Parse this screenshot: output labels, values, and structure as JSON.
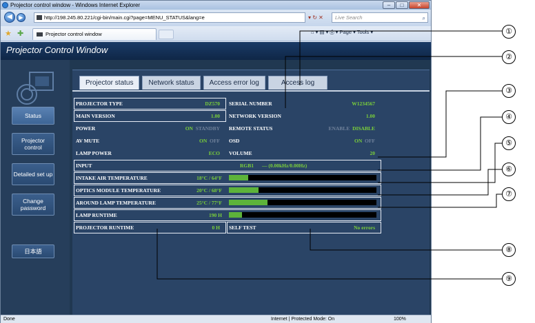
{
  "browser": {
    "title": "Projector control window - Windows Internet Explorer",
    "url": "http://198.245.80.221/cgi-bin/main.cgi?page=MENU_STATUS&lang=e",
    "search_placeholder": "Live Search",
    "tab_title": "Projector control window",
    "command_bar": "Page ▾   Tools ▾",
    "status_done": "Done",
    "status_zone": "Internet | Protected Mode: On",
    "status_zoom": "100%"
  },
  "page": {
    "title": "Projector Control Window",
    "sidebar": [
      {
        "label": "Status"
      },
      {
        "label": "Projector control"
      },
      {
        "label": "Detailed set up"
      },
      {
        "label": "Change password"
      },
      {
        "label": "日本語"
      }
    ],
    "tabs": [
      {
        "label": "Projector status"
      },
      {
        "label": "Network status"
      },
      {
        "label": "Access error log"
      },
      {
        "label": "Access log"
      }
    ]
  },
  "status": {
    "projector_type": {
      "label": "PROJECTOR TYPE",
      "value": "DZ570"
    },
    "serial_number": {
      "label": "SERIAL NUMBER",
      "value": "W1234567"
    },
    "main_version": {
      "label": "MAIN VERSION",
      "value": "1.00"
    },
    "network_version": {
      "label": "NETWORK VERSION",
      "value": "1.00"
    },
    "power": {
      "label": "POWER",
      "on": "ON",
      "standby": "STANDBY"
    },
    "remote_status": {
      "label": "REMOTE STATUS",
      "enable": "ENABLE",
      "disable": "DISABLE"
    },
    "av_mute": {
      "label": "AV MUTE",
      "on": "ON",
      "off": "OFF"
    },
    "osd": {
      "label": "OSD",
      "on": "ON",
      "off": "OFF"
    },
    "lamp_power": {
      "label": "LAMP POWER",
      "value": "ECO"
    },
    "volume": {
      "label": "VOLUME",
      "value": "20"
    },
    "input": {
      "label": "INPUT",
      "value": "RGB1",
      "detail": "— (0.00kHz/0.00Hz)"
    },
    "intake_air_temp": {
      "label": "INTAKE AIR TEMPERATURE",
      "value": "18°C / 64°F",
      "level": 0.13
    },
    "optics_module_temp": {
      "label": "OPTICS MODULE TEMPERATURE",
      "value": "20°C / 68°F",
      "level": 0.2
    },
    "around_lamp_temp": {
      "label": "AROUND LAMP TEMPERATURE",
      "value": "25°C / 77°F",
      "level": 0.26
    },
    "lamp_runtime": {
      "label": "LAMP RUNTIME",
      "value": "190 H",
      "level": 0.09
    },
    "projector_runtime": {
      "label": "PROJECTOR RUNTIME",
      "value": "0 H"
    },
    "self_test": {
      "label": "SELF TEST",
      "value": "No errors"
    }
  },
  "callouts": [
    "①",
    "②",
    "③",
    "④",
    "⑤",
    "⑥",
    "⑦",
    "⑧",
    "⑨"
  ]
}
